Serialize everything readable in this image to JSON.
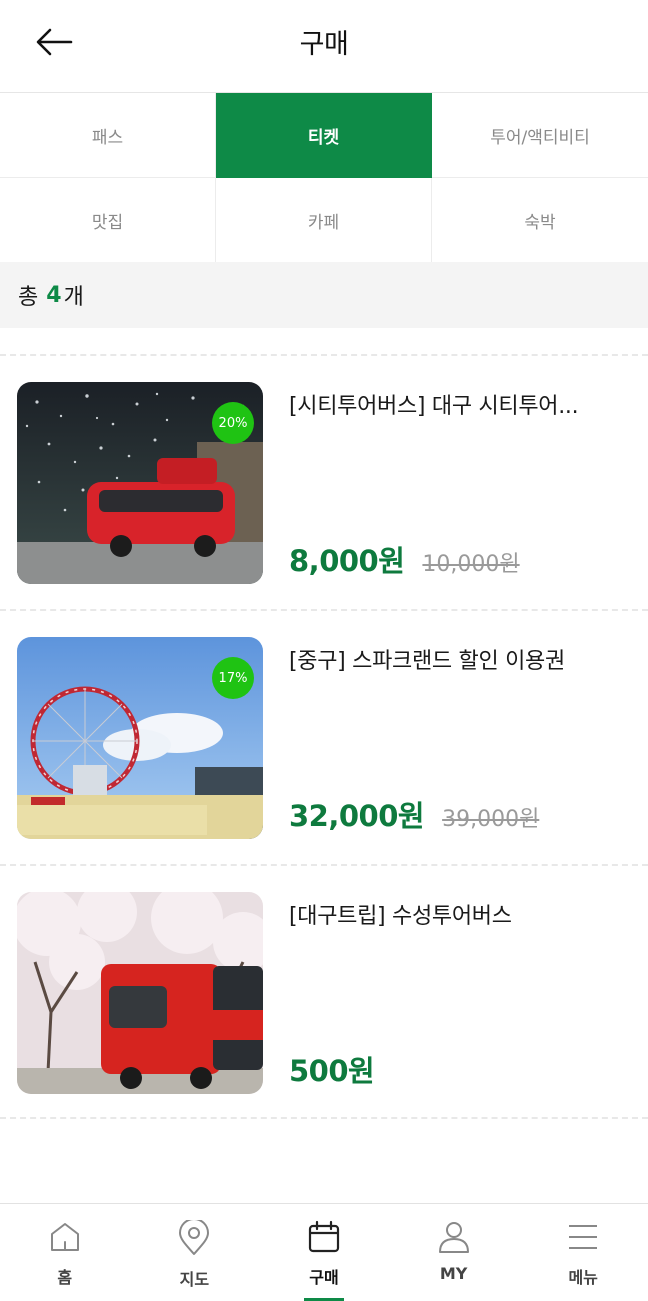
{
  "header": {
    "title": "구매"
  },
  "tabs": [
    {
      "label": "패스",
      "active": false
    },
    {
      "label": "티켓",
      "active": true
    },
    {
      "label": "투어/액티비티",
      "active": false
    },
    {
      "label": "맛집",
      "active": false
    },
    {
      "label": "카페",
      "active": false
    },
    {
      "label": "숙박",
      "active": false
    }
  ],
  "summary": {
    "prefix": "총",
    "count": "4",
    "suffix": "개"
  },
  "products": [
    {
      "title": "[시티투어버스] 대구 시티투어...",
      "price": "8,000원",
      "original_price": "10,000원",
      "discount": "20%"
    },
    {
      "title": "[중구] 스파크랜드 할인 이용권",
      "price": "32,000원",
      "original_price": "39,000원",
      "discount": "17%"
    },
    {
      "title": "[대구트립] 수성투어버스",
      "price": "500원",
      "original_price": "",
      "discount": ""
    }
  ],
  "bottom_nav": [
    {
      "label": "홈",
      "icon": "home-icon",
      "active": false
    },
    {
      "label": "지도",
      "icon": "map-pin-icon",
      "active": false
    },
    {
      "label": "구매",
      "icon": "calendar-icon",
      "active": true
    },
    {
      "label": "MY",
      "icon": "user-icon",
      "active": false
    },
    {
      "label": "메뉴",
      "icon": "menu-icon",
      "active": false
    }
  ],
  "colors": {
    "accent": "#0e8a47",
    "price": "#0e7a3e",
    "badge": "#1fc313"
  }
}
